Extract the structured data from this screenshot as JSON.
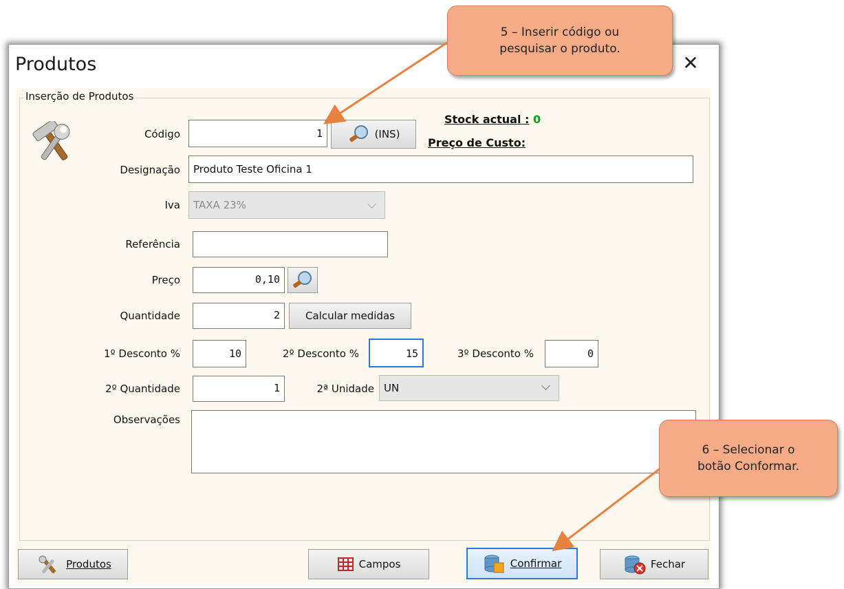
{
  "window": {
    "title": "Produtos",
    "close_glyph": "✕"
  },
  "group_label": "Inserção de Produtos",
  "header_icon": "tools-icon",
  "codigo": {
    "label": "Código",
    "value": "1",
    "search_button": "(INS)"
  },
  "stock": {
    "label": "Stock actual :",
    "value": "0",
    "value_color": "#1a9a1a",
    "custo_label": "Preço de Custo:"
  },
  "designacao": {
    "label": "Designação",
    "value": "Produto Teste Oficina 1"
  },
  "iva": {
    "label": "Iva",
    "value": "TAXA 23%"
  },
  "referencia": {
    "label": "Referência",
    "value": ""
  },
  "preco": {
    "label": "Preço",
    "value": "0,10"
  },
  "quantidade": {
    "label": "Quantidade",
    "value": "2",
    "calc_button": "Calcular medidas"
  },
  "descontos": {
    "d1_label": "1º Desconto %",
    "d1_value": "10",
    "d2_label": "2º Desconto %",
    "d2_value": "15",
    "d3_label": "3º Desconto %",
    "d3_value": "0"
  },
  "quantidade2": {
    "label": "2º Quantidade",
    "value": "1",
    "unidade_label": "2ª Unidade",
    "unidade_value": "UN"
  },
  "observacoes": {
    "label": "Observações",
    "value": ""
  },
  "footer": {
    "produtos": "Produtos",
    "campos": "Campos",
    "confirmar": "Confirmar",
    "fechar": "Fechar"
  },
  "callouts": {
    "step5_line1": "5 – Inserir código ou",
    "step5_line2": "pesquisar o produto.",
    "step6_line1": "6 – Selecionar o",
    "step6_line2": "botão Conformar."
  },
  "colors": {
    "callout_fill": "#f4ab86",
    "arrow": "#e8813f",
    "panel_bg": "#fdf9ee",
    "focus_border": "#2b79d6"
  }
}
